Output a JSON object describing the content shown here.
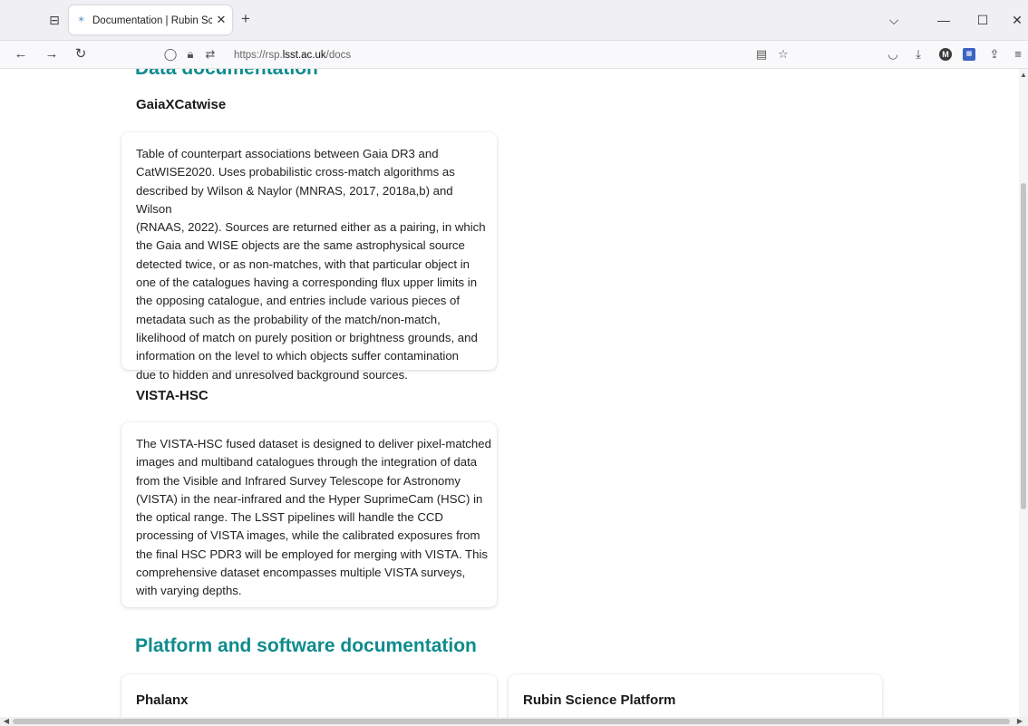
{
  "browser": {
    "tab_list_icon": "tab-list-icon",
    "tab": {
      "title": "Documentation | Rubin Science",
      "close": "✕",
      "favicon": "rubin-favicon"
    },
    "new_tab": "+",
    "window": {
      "list": "⌵",
      "minimize": "—",
      "maximize": "☐",
      "close": "✕"
    },
    "nav": {
      "back": "←",
      "forward": "→",
      "reload": "↻"
    },
    "url": {
      "prefix": "https://rsp.",
      "domain": "lsst.ac.uk",
      "path": "/docs"
    }
  },
  "page": {
    "section_data_heading": "Data documentation",
    "gaia": {
      "title": "GaiaXCatwise",
      "lines": [
        "Table of counterpart associations between Gaia DR3 and",
        "CatWISE2020. Uses probabilistic cross-match algorithms as",
        "described by Wilson & Naylor (MNRAS, 2017, 2018a,b) and Wilson",
        "(RNAAS, 2022). Sources are returned either as a pairing, in which",
        "the Gaia and WISE objects are the same astrophysical source",
        "detected twice, or as non-matches, with that particular object in",
        "one of the catalogues having a corresponding flux upper limits in",
        "the opposing catalogue, and entries include various pieces of",
        "metadata such as the probability of the match/non-match,",
        "likelihood of match on purely position or brightness grounds, and",
        "information on the level to which objects suffer contamination",
        "due to hidden and unresolved background sources."
      ]
    },
    "vista": {
      "title": "VISTA-HSC",
      "lines": [
        "The VISTA-HSC fused dataset is designed to deliver pixel-matched",
        "images and multiband catalogues through the integration of data",
        "from the Visible and Infrared Survey Telescope for Astronomy",
        "(VISTA) in the near-infrared and the Hyper SuprimeCam (HSC) in",
        "the optical range. The LSST pipelines will handle the CCD",
        "processing of VISTA images, while the calibrated exposures from",
        "the final HSC PDR3 will be employed for merging with VISTA. This",
        "comprehensive dataset encompasses multiple VISTA surveys,",
        "with varying depths."
      ]
    },
    "section_platform_heading": "Platform and software documentation",
    "phalanx": {
      "title": "Phalanx"
    },
    "rsp": {
      "title": "Rubin Science Platform"
    }
  },
  "colors": {
    "accent": "#0f8b8d",
    "text": "#222222"
  }
}
